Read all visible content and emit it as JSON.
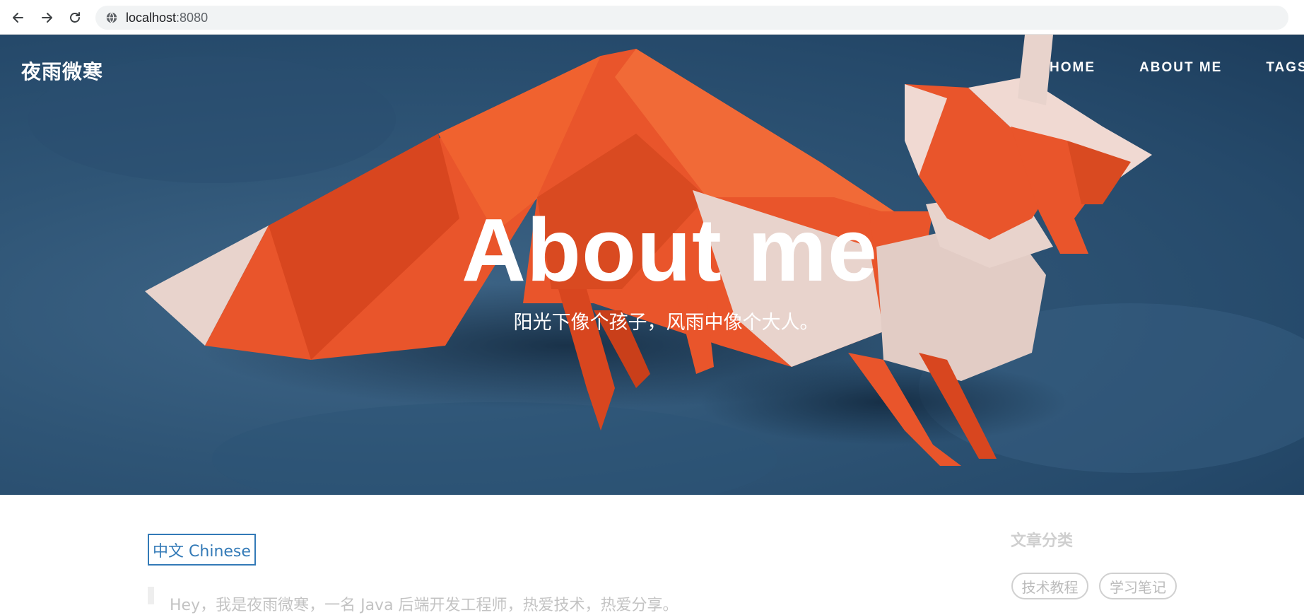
{
  "browser": {
    "url_host": "localhost",
    "url_port": ":8080"
  },
  "header": {
    "brand": "夜雨微寒",
    "nav": [
      {
        "label": "HOME"
      },
      {
        "label": "ABOUT ME"
      },
      {
        "label": "TAGS"
      }
    ]
  },
  "hero": {
    "title": "About me",
    "subtitle": "阳光下像个孩子，风雨中像个大人。"
  },
  "main": {
    "language_button": "中文 Chinese",
    "intro_text": "Hey，我是夜雨微寒，一名 Java 后端开发工程师，热爱技术，热爱分享。"
  },
  "sidebar": {
    "heading": "文章分类",
    "tags": [
      "技术教程",
      "学习笔记"
    ]
  },
  "colors": {
    "link_blue": "#337ab7",
    "hero_background": "#2f5576",
    "fox_orange": "#e9552b",
    "fox_cream": "#e8d3cc"
  }
}
